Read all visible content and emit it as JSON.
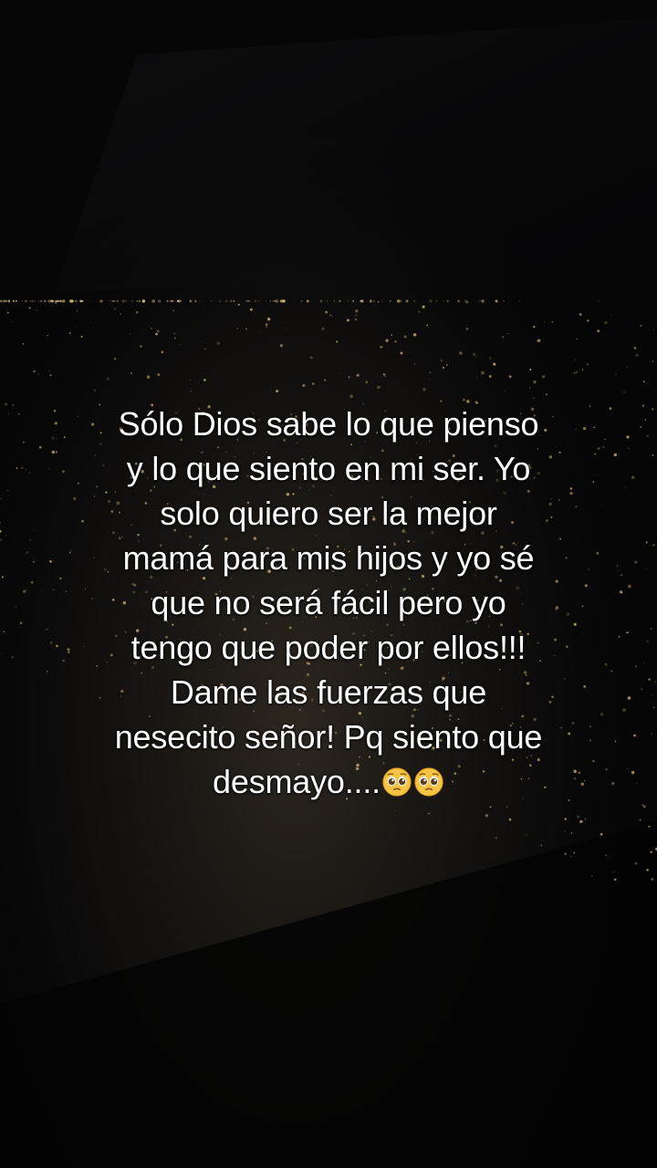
{
  "caption": {
    "lines": [
      "Sólo Dios sabe lo que pienso",
      "y lo que siento en mi ser. Yo",
      "solo quiero ser la mejor",
      "mamá para mis hijos y yo sé",
      "que no será fácil pero yo",
      "tengo que poder por ellos!!!",
      "Dame las fuerzas que",
      "nesecito señor! Pq siento que",
      "desmayo...."
    ],
    "emoji_icons": [
      "pleading-face-icon",
      "pleading-face-icon"
    ]
  },
  "colors": {
    "background": "#060607",
    "text": "#ffffff",
    "city_lights": "#e8c98a"
  }
}
